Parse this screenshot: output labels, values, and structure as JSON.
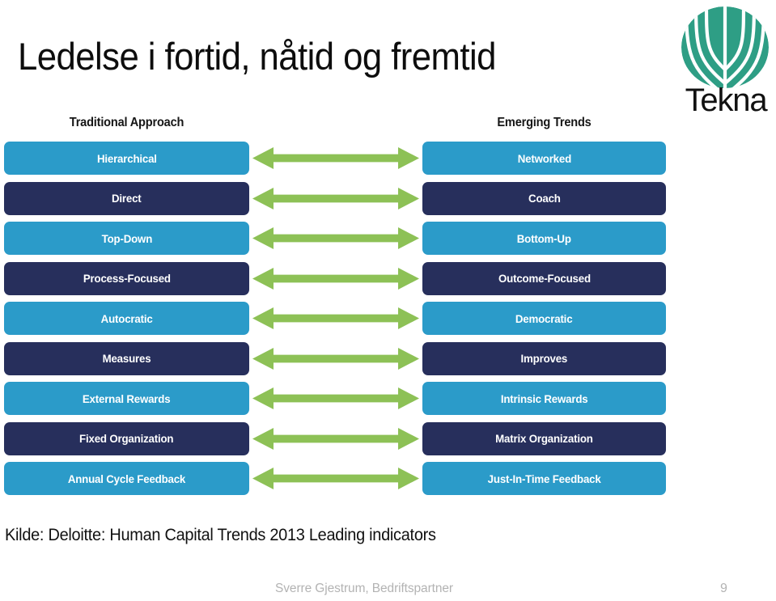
{
  "slide": {
    "title": "Ledelse i fortid, nåtid og fremtid",
    "source_note": "Kilde: Deloitte: Human Capital Trends 2013 Leading indicators"
  },
  "logo": {
    "wordmark": "Tekna",
    "mark_name": "tekna-arch-mark",
    "color": "#2E9E85"
  },
  "diagram": {
    "left_header": "Traditional Approach",
    "right_header": "Emerging Trends",
    "colors": {
      "navy": "#272F5C",
      "blue": "#2B9BC9",
      "arrow_green": "#8DC156"
    },
    "rows": [
      {
        "left": "Hierarchical",
        "right": "Networked",
        "style": "blue",
        "arrow": "double-arrow"
      },
      {
        "left": "Direct",
        "right": "Coach",
        "style": "navy",
        "arrow": "double-arrow"
      },
      {
        "left": "Top-Down",
        "right": "Bottom-Up",
        "style": "blue",
        "arrow": "double-arrow"
      },
      {
        "left": "Process-Focused",
        "right": "Outcome-Focused",
        "style": "navy",
        "arrow": "double-arrow"
      },
      {
        "left": "Autocratic",
        "right": "Democratic",
        "style": "blue",
        "arrow": "double-arrow"
      },
      {
        "left": "Measures",
        "right": "Improves",
        "style": "navy",
        "arrow": "double-arrow"
      },
      {
        "left": "External Rewards",
        "right": "Intrinsic Rewards",
        "style": "blue",
        "arrow": "double-arrow"
      },
      {
        "left": "Fixed Organization",
        "right": "Matrix Organization",
        "style": "navy",
        "arrow": "double-arrow"
      },
      {
        "left": "Annual Cycle Feedback",
        "right": "Just-In-Time Feedback",
        "style": "blue",
        "arrow": "double-arrow"
      }
    ]
  },
  "footer": {
    "author": "Sverre Gjestrum, Bedriftspartner",
    "page_number": "9"
  }
}
